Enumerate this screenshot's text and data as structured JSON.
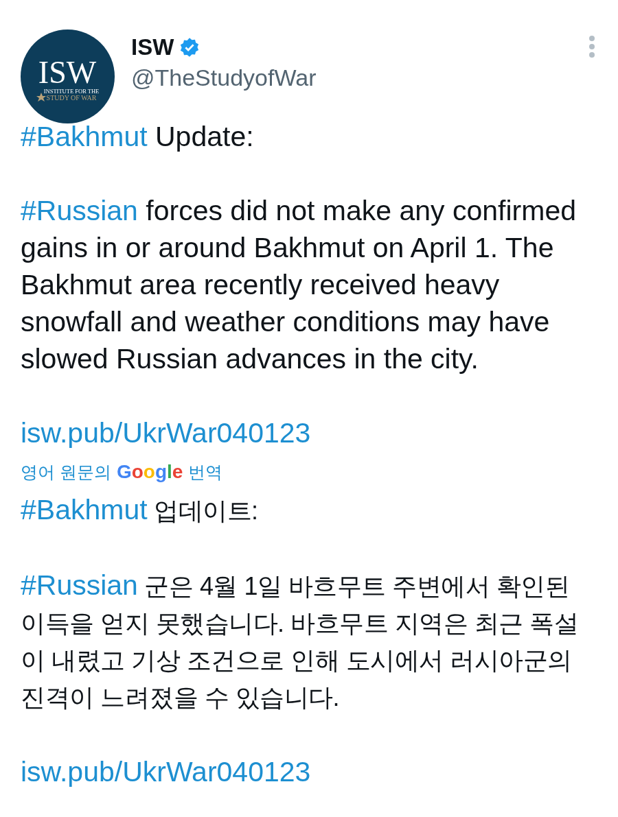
{
  "author": {
    "avatar": {
      "wordmark": "ISW",
      "tagline_1": "INSTITUTE FOR THE",
      "tagline_2": "STUDY OF WAR"
    },
    "name": "ISW",
    "verified": true,
    "handle": "@TheStudyofWar"
  },
  "original": [
    [
      {
        "kind": "hashtag",
        "text": "#Bakhmut"
      },
      {
        "kind": "text",
        "text": " Update:"
      }
    ],
    [
      {
        "kind": "hashtag",
        "text": "#Russian"
      },
      {
        "kind": "text",
        "text": " forces did not make any confirmed gains in or around Bakhmut on April 1. The Bakhmut area recently received heavy snowfall and weather conditions may have slowed Russian advances in the city."
      }
    ],
    [
      {
        "kind": "link",
        "text": "isw.pub/UkrWar040123"
      }
    ]
  ],
  "translation_label": {
    "before": "영어 원문의",
    "brand": "Google",
    "after": "번역"
  },
  "translated": [
    [
      {
        "kind": "hashtag",
        "text": "#Bakhmut"
      },
      {
        "kind": "text",
        "text": " 업데이트:"
      }
    ],
    [
      {
        "kind": "hashtag",
        "text": "#Russian"
      },
      {
        "kind": "text",
        "text": " 군은 4월 1일 바흐무트 주변에서 확인된 이득을 얻지 못했습니다. 바흐무트 지역은 최근 폭설이 내렸고 기상 조건으로 인해 도시에서 러시아군의 진격이 느려졌을 수 있습니다."
      }
    ],
    [
      {
        "kind": "link",
        "text": "isw.pub/UkrWar040123"
      }
    ]
  ]
}
